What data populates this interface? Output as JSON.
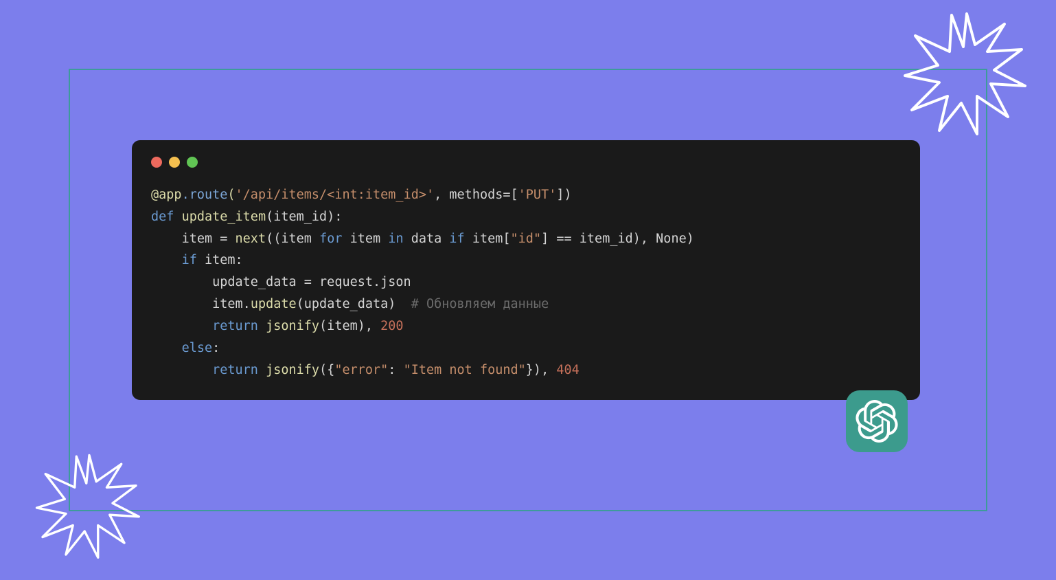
{
  "colors": {
    "background": "#7c7eec",
    "frame": "#3d9b9a",
    "window": "#1a1a1a",
    "badge": "#3c9b8d"
  },
  "traffic": {
    "red": "#ed6a5e",
    "yellow": "#f4bf4f",
    "green": "#61c554"
  },
  "code": {
    "l1": {
      "prefix": "@app",
      "method": ".route",
      "open": "(",
      "str": "'/api/items/<int:item_id>'",
      "mid": ", methods=[",
      "str2": "'PUT'",
      "close": "])"
    },
    "l2": {
      "kw": "def",
      "sp": " ",
      "fn": "update_item",
      "params": "(item_id):"
    },
    "l3": {
      "indent": "    ",
      "text1": "item = ",
      "fn": "next",
      "text2": "((item ",
      "kw1": "for",
      "text3": " item ",
      "kw2": "in",
      "text4": " data ",
      "kw3": "if",
      "text5": " item[",
      "str": "\"id\"",
      "text6": "] == item_id), ",
      "const": "None",
      "text7": ")"
    },
    "l4": {
      "indent": "    ",
      "kw": "if",
      "text": " item:"
    },
    "l5": {
      "indent": "        ",
      "text": "update_data = request.json"
    },
    "l6": {
      "indent": "        ",
      "text1": "item.",
      "fn": "update",
      "text2": "(update_data)  ",
      "cmt": "# Обновляем данные"
    },
    "l7": {
      "indent": "        ",
      "kw": "return",
      "sp": " ",
      "fn": "jsonify",
      "text": "(item), ",
      "num": "200"
    },
    "l8": {
      "indent": "    ",
      "kw": "else",
      "text": ":"
    },
    "l9": {
      "indent": "        ",
      "kw": "return",
      "sp": " ",
      "fn": "jsonify",
      "text1": "({",
      "str1": "\"error\"",
      "text2": ": ",
      "str2": "\"Item not found\"",
      "text3": "}), ",
      "num": "404"
    }
  }
}
